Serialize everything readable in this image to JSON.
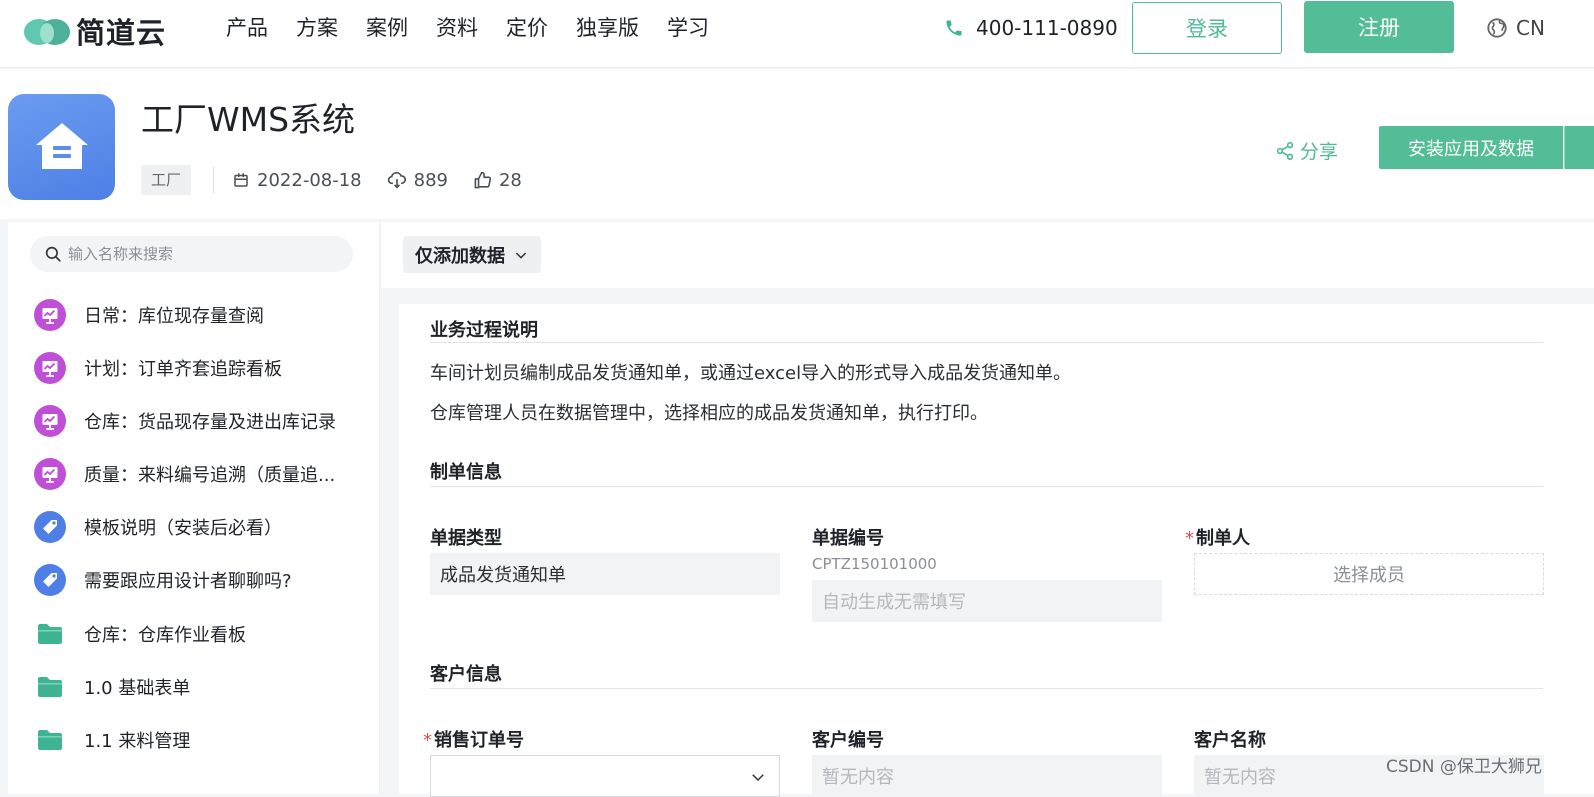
{
  "brand": {
    "name": "简道云",
    "accent": "#52bd96",
    "logo_colors": [
      "#5ec9b0",
      "#3aa98c"
    ]
  },
  "nav": {
    "items": [
      "产品",
      "方案",
      "案例",
      "资料",
      "定价",
      "独享版",
      "学习"
    ]
  },
  "contact": {
    "phone": "400-111-0890"
  },
  "auth": {
    "login_label": "登录",
    "register_label": "注册"
  },
  "language": {
    "current": "CN"
  },
  "app": {
    "title": "工厂WMS系统",
    "tag": "工厂",
    "date": "2022-08-18",
    "downloads": "889",
    "likes": "28",
    "icon": "house-icon",
    "icon_color": "#5b8def",
    "share_label": "分享",
    "install_label": "安装应用及数据"
  },
  "sidebar": {
    "search_placeholder": "输入名称来搜索",
    "items": [
      {
        "label": "日常：库位现存量查阅",
        "icon": "dashboard-icon",
        "color": "#c04fd8"
      },
      {
        "label": "计划：订单齐套追踪看板",
        "icon": "dashboard-icon",
        "color": "#c04fd8"
      },
      {
        "label": "仓库：货品现存量及进出库记录",
        "icon": "dashboard-icon",
        "color": "#c04fd8"
      },
      {
        "label": "质量：来料编号追溯（质量追...",
        "icon": "dashboard-icon",
        "color": "#c04fd8"
      },
      {
        "label": "模板说明（安装后必看）",
        "icon": "tag-icon",
        "color": "#4d7fe6"
      },
      {
        "label": "需要跟应用设计者聊聊吗?",
        "icon": "tag-icon",
        "color": "#4d7fe6"
      },
      {
        "label": "仓库：仓库作业看板",
        "icon": "folder-icon",
        "color": "#3fb493"
      },
      {
        "label": "1.0 基础表单",
        "icon": "folder-icon",
        "color": "#3fb493"
      },
      {
        "label": "1.1 来料管理",
        "icon": "folder-icon",
        "color": "#3fb493"
      }
    ]
  },
  "main": {
    "mode_label": "仅添加数据",
    "sections": {
      "process": {
        "title": "业务过程说明",
        "lines": [
          "车间计划员编制成品发货通知单，或通过excel导入的形式导入成品发货通知单。",
          "仓库管理人员在数据管理中，选择相应的成品发货通知单，执行打印。"
        ]
      },
      "order_info": {
        "title": "制单信息",
        "doc_type_label": "单据类型",
        "doc_type_value": "成品发货通知单",
        "doc_no_label": "单据编号",
        "doc_no_hint": "CPTZ150101000",
        "doc_no_placeholder": "自动生成无需填写",
        "maker_label": "制单人",
        "maker_placeholder": "选择成员"
      },
      "customer_info": {
        "title": "客户信息",
        "sales_order_label": "销售订单号",
        "customer_no_label": "客户编号",
        "customer_no_placeholder": "暂无内容",
        "customer_name_label": "客户名称",
        "customer_name_placeholder": "暂无内容"
      }
    }
  },
  "watermark": "CSDN @保卫大狮兄"
}
